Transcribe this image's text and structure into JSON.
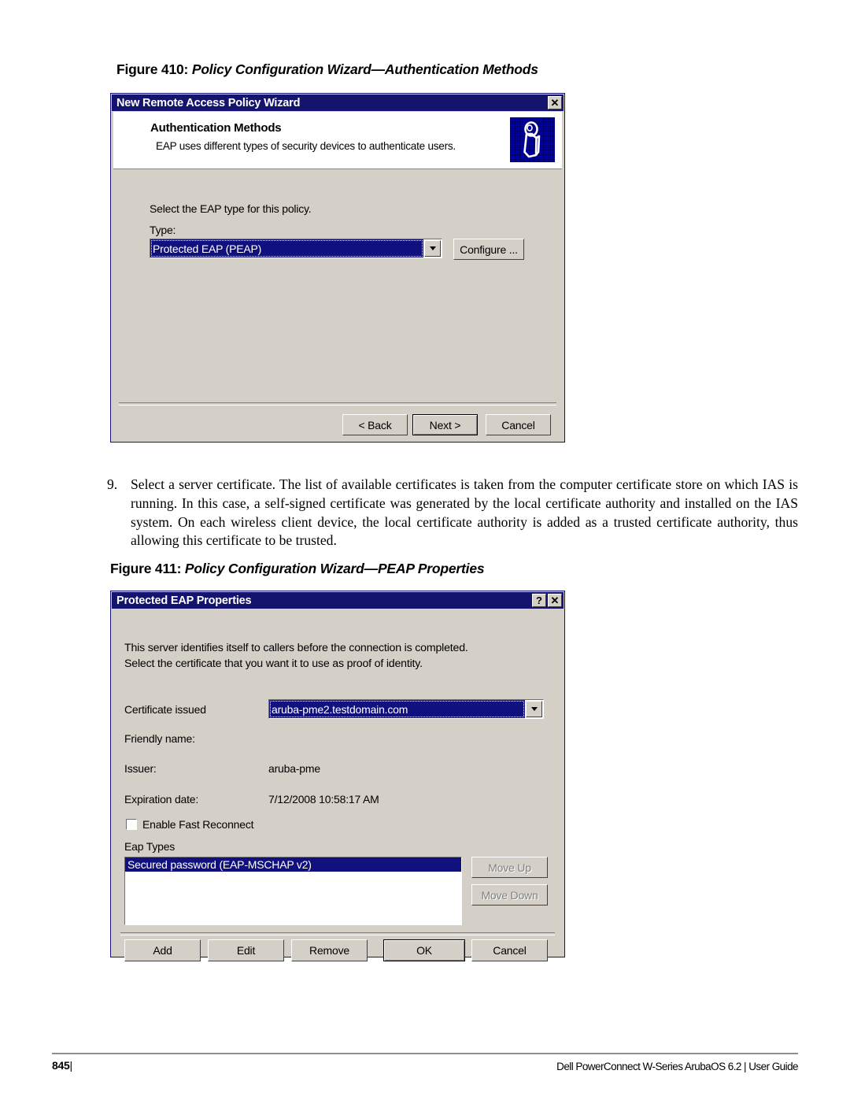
{
  "figure410": {
    "number": "Figure 410:",
    "title": "Policy Configuration Wizard—Authentication Methods"
  },
  "figure411": {
    "number": "Figure 411:",
    "title": "Policy Configuration Wizard—PEAP Properties"
  },
  "step9": {
    "number": "9.",
    "text": "Select a server certificate. The list of available certificates is taken from the computer certificate store on which IAS is running. In this case, a self-signed certificate was generated by the local certificate authority and installed on the IAS system. On each wireless client device, the local certificate authority is added as a trusted certificate authority, thus allowing this certificate to be trusted."
  },
  "wizard_dialog": {
    "title": "New Remote Access Policy Wizard",
    "close_label": "✕",
    "header_title": "Authentication Methods",
    "header_subtitle": "EAP uses different types of security devices to authenticate users.",
    "instruction": "Select the EAP type for this policy.",
    "type_label": "Type:",
    "type_value": "Protected EAP (PEAP)",
    "configure_label": "Configure ...",
    "back_label": "< Back",
    "next_label": "Next >",
    "cancel_label": "Cancel"
  },
  "peap_dialog": {
    "title": "Protected EAP Properties",
    "help_label": "?",
    "close_label": "✕",
    "intro_line1": "This server identifies itself to callers before the connection is completed.",
    "intro_line2": "Select the certificate that you want it to use as proof of identity.",
    "cert_issued_label": "Certificate issued",
    "cert_issued_value": "aruba-pme2.testdomain.com",
    "friendly_name_label": "Friendly name:",
    "friendly_name_value": "",
    "issuer_label": "Issuer:",
    "issuer_value": "aruba-pme",
    "expiration_label": "Expiration date:",
    "expiration_value": "7/12/2008 10:58:17 AM",
    "fast_reconnect_label": "Enable Fast Reconnect",
    "fast_reconnect_checked": false,
    "eap_types_label": "Eap Types",
    "eap_types": [
      {
        "label": "Secured password (EAP-MSCHAP v2)",
        "selected": true
      }
    ],
    "move_up_label": "Move Up",
    "move_down_label": "Move Down",
    "add_label": "Add",
    "edit_label": "Edit",
    "remove_label": "Remove",
    "ok_label": "OK",
    "cancel_label": "Cancel"
  },
  "footer": {
    "page_number": "845",
    "page_bar": "|",
    "product": "Dell PowerConnect W-Series ArubaOS 6.2 | User Guide"
  },
  "colors": {
    "titlebar_blue": "#14146e",
    "selection_blue": "#10107e",
    "dialog_face": "#d4d0c8",
    "wizard_icon_blue": "#0000a6"
  }
}
